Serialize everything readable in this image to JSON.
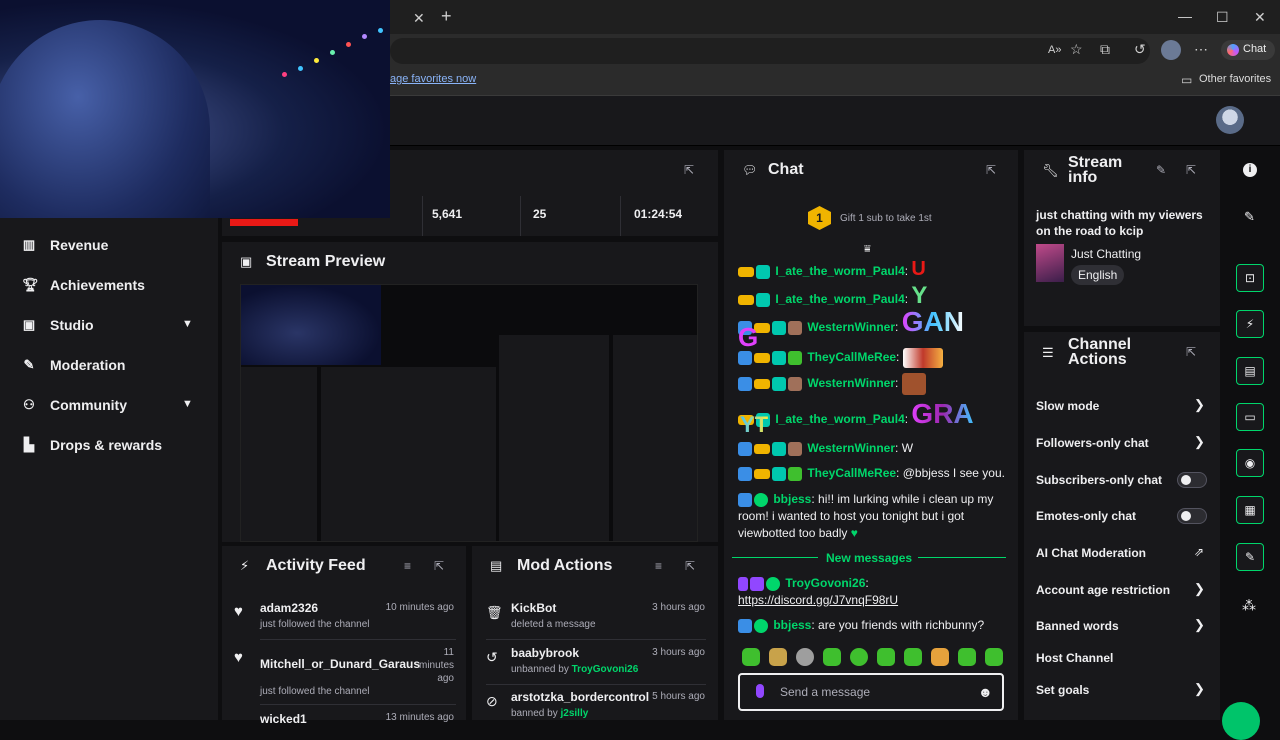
{
  "browser": {
    "favorites_link": "age favorites now",
    "other_favorites": "Other favorites",
    "chat_button": "Chat"
  },
  "sidebar": {
    "items": [
      {
        "label": "Revenue",
        "icon": "bar-chart-icon"
      },
      {
        "label": "Achievements",
        "icon": "trophy-icon"
      },
      {
        "label": "Studio",
        "icon": "film-icon",
        "expandable": true
      },
      {
        "label": "Moderation",
        "icon": "wrench-icon"
      },
      {
        "label": "Community",
        "icon": "people-icon",
        "expandable": true
      },
      {
        "label": "Drops & rewards",
        "icon": "podium-icon"
      }
    ]
  },
  "stats": {
    "followers": "5,641",
    "subs": "25",
    "uptime": "01:24:54"
  },
  "stream_preview": {
    "title": "Stream Preview"
  },
  "activity_feed": {
    "title": "Activity Feed",
    "items": [
      {
        "name": "adam2326",
        "sub": "just followed the channel",
        "time": "10 minutes ago"
      },
      {
        "name": "Mitchell_or_Dunard_Garaus",
        "sub": "just followed the channel",
        "time": "11 minutes ago"
      },
      {
        "name": "wicked1",
        "sub": "",
        "time": "13 minutes ago"
      }
    ]
  },
  "mod_actions": {
    "title": "Mod Actions",
    "items": [
      {
        "name": "KickBot",
        "sub": "deleted a message",
        "actor": "",
        "time": "3 hours ago"
      },
      {
        "name": "baabybrook",
        "sub": "unbanned by",
        "actor": "TroyGovoni26",
        "time": "3 hours ago"
      },
      {
        "name": "arstotzka_bordercontrol",
        "sub": "banned by",
        "actor": "j2silly",
        "time": "5 hours ago"
      }
    ]
  },
  "chat": {
    "title": "Chat",
    "gift_banner": "Gift 1 sub to take 1st",
    "gift_rank": "1",
    "messages": [
      {
        "user": "I_ate_the_worm_Paul4",
        "text": "U",
        "color": "#00d66b"
      },
      {
        "user": "I_ate_the_worm_Paul4",
        "text": "Y",
        "color": "#00d66b"
      },
      {
        "user": "WesternWinner",
        "text": "GAN",
        "color": "#00d66b"
      },
      {
        "user": "TheyCallMeRee",
        "text": "",
        "color": "#00d66b"
      },
      {
        "user": "WesternWinner",
        "text": "",
        "color": "#00d66b"
      },
      {
        "user": "I_ate_the_worm_Paul4",
        "text": "GRA",
        "color": "#00d66b"
      },
      {
        "user": "WesternWinner",
        "text": "W",
        "color": "#00d66b"
      },
      {
        "user": "TheyCallMeRee",
        "text": "@bbjess I see you.",
        "color": "#00d66b"
      },
      {
        "user": "bbjess",
        "text": "hi!! im lurking while i clean up my room! i wanted to host you tonight but i got viewbotted too badly",
        "color": "#00d66b"
      },
      {
        "user": "TroyGovoni26",
        "text": "https://discord.gg/J7vnqF98rU",
        "color": "#00d66b"
      },
      {
        "user": "bbjess",
        "text": "are you friends with richbunny?",
        "color": "#00d66b"
      }
    ],
    "extra_letters": {
      "g": "G",
      "yt": "YT"
    },
    "new_messages": "New messages",
    "input_placeholder": "Send a message"
  },
  "stream_info": {
    "title": "Stream info",
    "description": "just chatting with my viewers on the road to kcip",
    "category": "Just Chatting",
    "language": "English"
  },
  "channel_actions": {
    "title": "Channel Actions",
    "rows": [
      {
        "label": "Slow mode",
        "control": "chevron"
      },
      {
        "label": "Followers-only chat",
        "control": "chevron"
      },
      {
        "label": "Subscribers-only chat",
        "control": "toggle",
        "on": false
      },
      {
        "label": "Emotes-only chat",
        "control": "toggle",
        "on": false
      },
      {
        "label": "AI Chat Moderation",
        "control": "external"
      },
      {
        "label": "Account age restriction",
        "control": "chevron"
      },
      {
        "label": "Banned words",
        "control": "chevron"
      },
      {
        "label": "Host Channel",
        "control": "none"
      },
      {
        "label": "Set goals",
        "control": "chevron"
      }
    ]
  },
  "colors": {
    "accent": "#00d66b",
    "bg": "#0e0e10",
    "panel": "#18181b"
  }
}
